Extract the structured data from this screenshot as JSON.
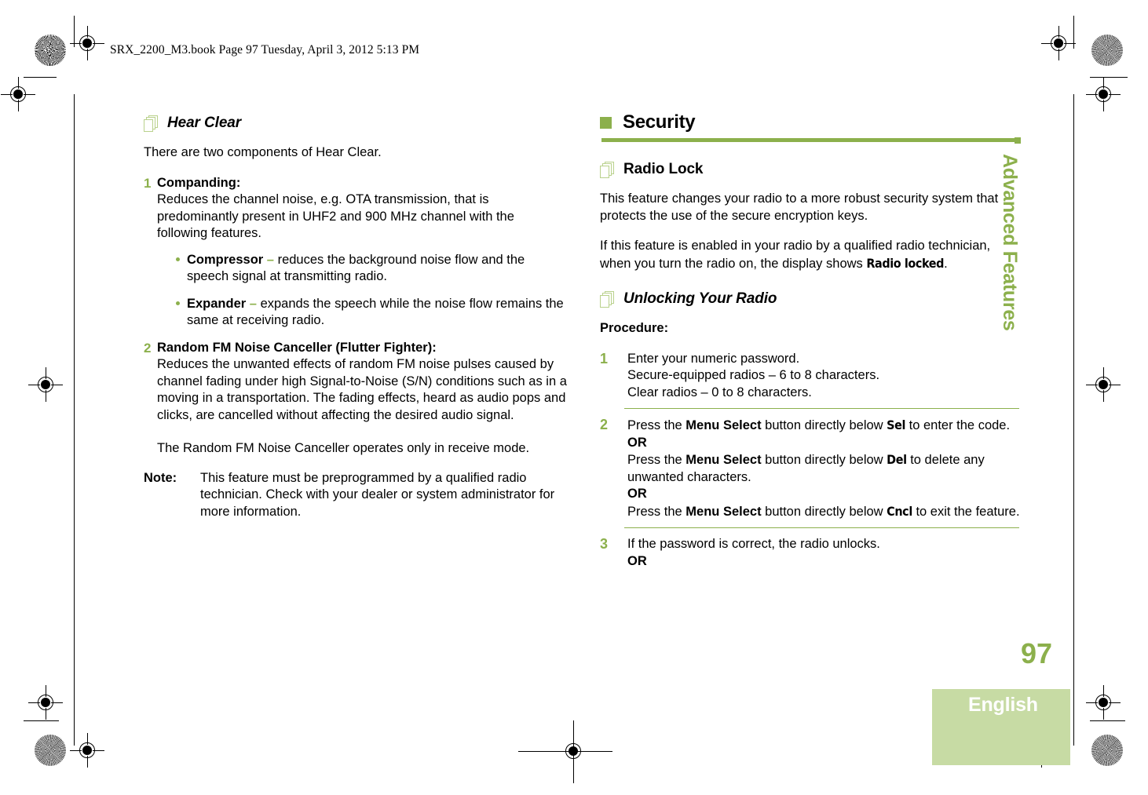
{
  "header": {
    "file_info": "SRX_2200_M3.book  Page 97  Tuesday, April 3, 2012  5:13 PM"
  },
  "colors": {
    "accent_green": "#8cb04c",
    "icon_green": "#b9d18c",
    "lang_box_green": "#c7dba4"
  },
  "left_column": {
    "heading": "Hear Clear",
    "heading_icon": "stacked-pages-icon",
    "intro": "There are two components of Hear Clear.",
    "steps": [
      {
        "number": "1",
        "title": "Companding:",
        "body": "Reduces the channel noise, e.g. OTA transmission, that is predominantly present in UHF2 and 900 MHz channel with the following features.",
        "bullets": [
          {
            "term": "Compressor",
            "dash": "–",
            "text": "reduces the background noise flow and the speech signal at transmitting radio."
          },
          {
            "term": "Expander",
            "dash": "–",
            "text": "expands the speech while the noise flow remains the same at receiving radio."
          }
        ]
      },
      {
        "number": "2",
        "title": "Random FM Noise Canceller (Flutter Fighter):",
        "body": "Reduces the unwanted effects of random FM noise pulses caused by channel fading under high Signal-to-Noise (S/N) conditions such as in a moving in a transportation. The fading effects, heard as audio pops and clicks, are cancelled without affecting the desired audio signal.",
        "body2": "The Random FM Noise Canceller operates only in receive mode."
      }
    ],
    "note": {
      "label": "Note:",
      "text": "This feature must be preprogrammed by a qualified radio technician. Check with your dealer or system administrator for more information."
    }
  },
  "right_column": {
    "section_heading": "Security",
    "radio_lock": {
      "heading": "Radio Lock",
      "heading_icon": "stacked-pages-icon",
      "para1": "This feature changes your radio to a more robust security system that protects the use of the secure encryption keys.",
      "para2_before": "If this feature is enabled in your radio by a qualified radio technician, when you turn the radio on, the display shows ",
      "para2_lcd": "Radio locked",
      "para2_after": "."
    },
    "unlocking": {
      "heading": "Unlocking Your Radio",
      "heading_icon": "stacked-pages-icon",
      "procedure_label": "Procedure:",
      "steps": [
        {
          "number": "1",
          "line1": "Enter your numeric password.",
          "line2": "Secure-equipped radios – 6 to 8 characters.",
          "line3": "Clear radios – 0 to 8 characters."
        },
        {
          "number": "2",
          "s1_a": "Press the ",
          "s1_b": "Menu Select",
          "s1_c": " button directly below ",
          "s1_lcd": "Sel",
          "s1_d": " to enter the code.",
          "or1": "OR",
          "s2_a": "Press the ",
          "s2_b": "Menu Select",
          "s2_c": " button directly below ",
          "s2_lcd": "Del",
          "s2_d": " to delete any unwanted characters.",
          "or2": "OR",
          "s3_a": "Press the ",
          "s3_b": "Menu Select",
          "s3_c": " button directly below ",
          "s3_lcd": "Cncl",
          "s3_d": " to exit the feature."
        },
        {
          "number": "3",
          "line1": "If the password is correct, the radio unlocks.",
          "or1": "OR"
        }
      ]
    }
  },
  "sidebar": {
    "chapter_title": "Advanced Features",
    "page_number": "97",
    "language": "English"
  }
}
